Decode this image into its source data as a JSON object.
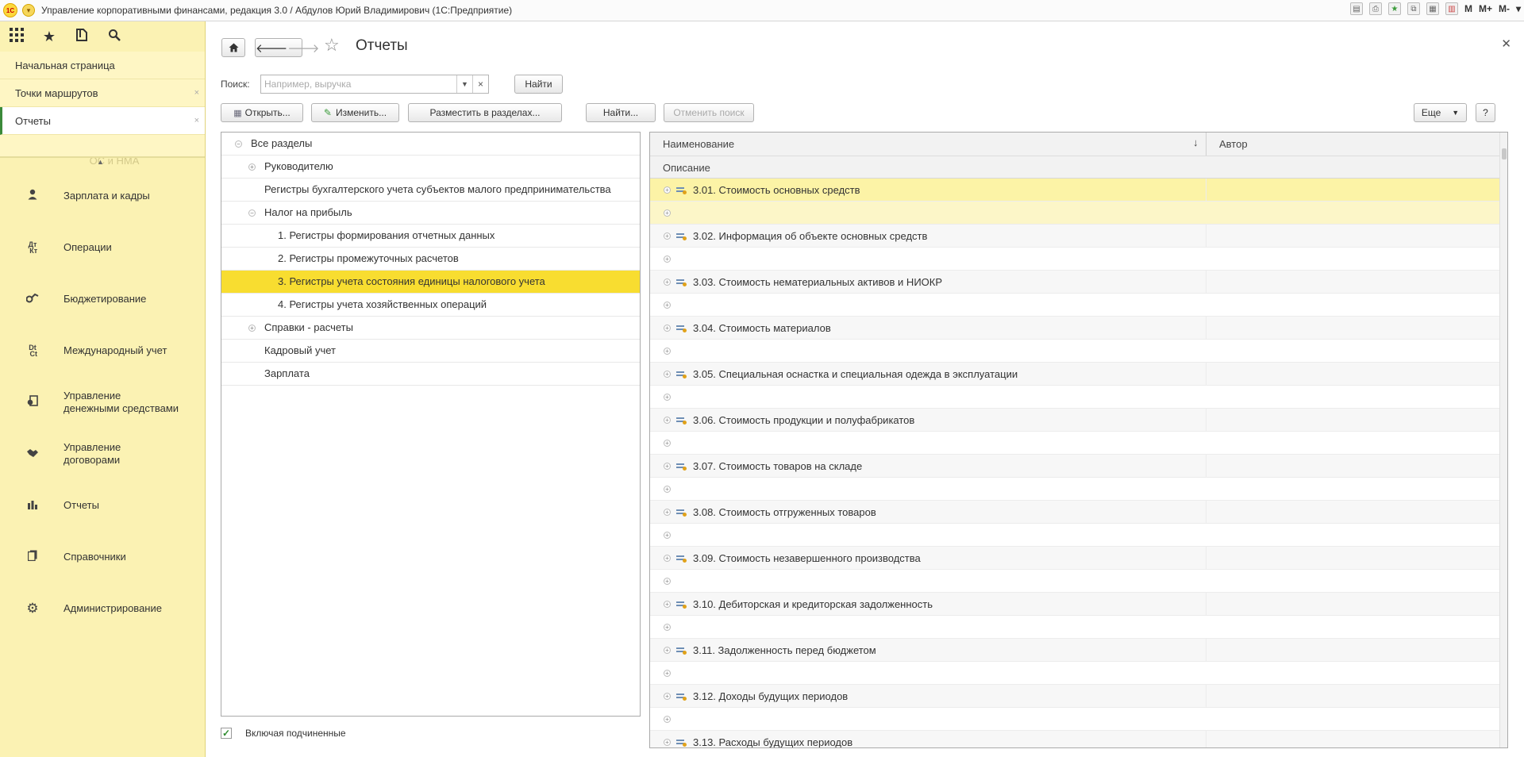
{
  "app": {
    "logo_text": "1С",
    "window_title": "Управление корпоративными финансами, редакция 3.0 / Абдулов Юрий Владимирович (1С:Предприятие)",
    "title_right": [
      "M",
      "M+",
      "M-"
    ]
  },
  "leftpanel": {
    "open_windows": [
      {
        "label": "Начальная страница",
        "active": false,
        "closable": false
      },
      {
        "label": "Точки маршрутов",
        "active": false,
        "closable": true
      },
      {
        "label": "Отчеты",
        "active": true,
        "closable": true
      }
    ],
    "partial_section": "ОС и НМА",
    "sections": [
      {
        "label": "Зарплата и кадры",
        "icon": "person-icon"
      },
      {
        "label": "Операции",
        "icon": "dt-kt-icon"
      },
      {
        "label": "Бюджетирование",
        "icon": "budget-icon"
      },
      {
        "label": "Международный учет",
        "icon": "international-icon"
      },
      {
        "label": "Управление\nденежными средствами",
        "icon": "money-icon"
      },
      {
        "label": "Управление\nдоговорами",
        "icon": "handshake-icon"
      },
      {
        "label": "Отчеты",
        "icon": "bar-chart-icon"
      },
      {
        "label": "Справочники",
        "icon": "book-icon"
      },
      {
        "label": "Администрирование",
        "icon": "gear-icon"
      }
    ]
  },
  "form": {
    "title": "Отчеты",
    "search": {
      "label": "Поиск:",
      "placeholder": "Например, выручка",
      "clear": "×",
      "find_button": "Найти"
    },
    "toolbar": {
      "open": "Открыть...",
      "edit": "Изменить...",
      "place": "Разместить в разделах...",
      "find": "Найти...",
      "cancel_search": "Отменить поиск",
      "more": "Еще",
      "help": "?"
    },
    "tree": [
      {
        "label": "Все разделы",
        "level": 0,
        "toggle": "−",
        "selected": false
      },
      {
        "label": "Руководителю",
        "level": 1,
        "toggle": "+",
        "selected": false
      },
      {
        "label": "Регистры бухгалтерского учета субъектов малого предпринимательства",
        "level": 1,
        "toggle": "",
        "selected": false
      },
      {
        "label": "Налог на прибыль",
        "level": 1,
        "toggle": "−",
        "selected": false
      },
      {
        "label": "1. Регистры формирования отчетных данных",
        "level": 2,
        "toggle": "",
        "selected": false
      },
      {
        "label": "2. Регистры промежуточных расчетов",
        "level": 2,
        "toggle": "",
        "selected": false
      },
      {
        "label": "3. Регистры учета состояния единицы налогового учета",
        "level": 2,
        "toggle": "",
        "selected": true
      },
      {
        "label": "4. Регистры учета хозяйственных операций",
        "level": 2,
        "toggle": "",
        "selected": false
      },
      {
        "label": "Справки - расчеты",
        "level": 1,
        "toggle": "+",
        "selected": false
      },
      {
        "label": "Кадровый учет",
        "level": 1,
        "toggle": "",
        "selected": false
      },
      {
        "label": "Зарплата",
        "level": 1,
        "toggle": "",
        "selected": false
      }
    ],
    "include_subordinate": {
      "label": "Включая подчиненные",
      "checked": true
    },
    "list": {
      "col_name": "Наименование",
      "sort_indicator": "↓",
      "col_author": "Автор",
      "col_description": "Описание",
      "reports": [
        "3.01. Стоимость основных средств",
        "3.02. Информация об объекте основных средств",
        "3.03. Стоимость нематериальных активов и НИОКР",
        "3.04. Стоимость материалов",
        "3.05. Специальная оснастка и специальная одежда в эксплуатации",
        "3.06. Стоимость продукции и полуфабрикатов",
        "3.07. Стоимость товаров на складе",
        "3.08. Стоимость отгруженных товаров",
        "3.09. Стоимость незавершенного производства",
        "3.10. Дебиторская и кредиторская задолженность",
        "3.11. Задолженность перед бюджетом",
        "3.12. Доходы будущих периодов",
        "3.13. Расходы будущих периодов"
      ]
    }
  }
}
